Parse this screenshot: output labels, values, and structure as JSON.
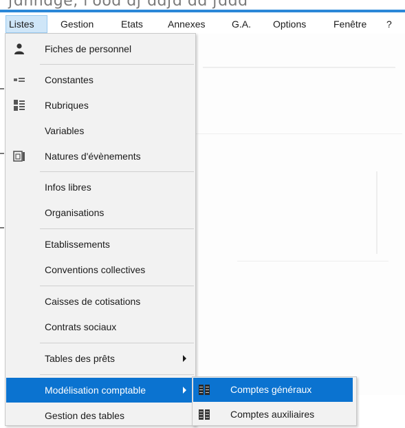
{
  "menubar": {
    "items": [
      {
        "label": "Listes",
        "active": true
      },
      {
        "label": "Gestion",
        "active": false
      },
      {
        "label": "Etats",
        "active": false
      },
      {
        "label": "Annexes",
        "active": false
      },
      {
        "label": "G.A.",
        "active": false
      },
      {
        "label": "Options",
        "active": false
      },
      {
        "label": "Fenêtre",
        "active": false
      },
      {
        "label": "?",
        "active": false
      }
    ]
  },
  "dropdown": {
    "items": [
      {
        "label": "Fiches de personnel",
        "icon": "person-icon",
        "submenu": false,
        "selected": false
      },
      {
        "label": "Constantes",
        "icon": "constants-icon",
        "submenu": false,
        "selected": false
      },
      {
        "label": "Rubriques",
        "icon": "list-icon",
        "submenu": false,
        "selected": false
      },
      {
        "label": "Variables",
        "icon": "",
        "submenu": false,
        "selected": false
      },
      {
        "label": "Natures d'évènements",
        "icon": "event-icon",
        "submenu": false,
        "selected": false
      },
      {
        "label": "Infos libres",
        "icon": "",
        "submenu": false,
        "selected": false
      },
      {
        "label": "Organisations",
        "icon": "",
        "submenu": false,
        "selected": false
      },
      {
        "label": "Etablissements",
        "icon": "",
        "submenu": false,
        "selected": false
      },
      {
        "label": "Conventions collectives",
        "icon": "",
        "submenu": false,
        "selected": false
      },
      {
        "label": "Caisses de cotisations",
        "icon": "",
        "submenu": false,
        "selected": false
      },
      {
        "label": "Contrats sociaux",
        "icon": "",
        "submenu": false,
        "selected": false
      },
      {
        "label": "Tables des prêts",
        "icon": "",
        "submenu": true,
        "selected": false
      },
      {
        "label": "Modélisation comptable",
        "icon": "",
        "submenu": true,
        "selected": true
      },
      {
        "label": "Gestion des tables",
        "icon": "",
        "submenu": false,
        "selected": false
      }
    ]
  },
  "submenu": {
    "items": [
      {
        "label": "Comptes généraux",
        "icon": "ledger-icon",
        "selected": true
      },
      {
        "label": "Comptes auxiliaires",
        "icon": "ledger-icon",
        "selected": false
      }
    ]
  },
  "colors": {
    "accent": "#2b88d8",
    "selection": "#0b73d0",
    "menu_bg": "#f2f2f2",
    "menubar_active": "#cfe6f8"
  }
}
